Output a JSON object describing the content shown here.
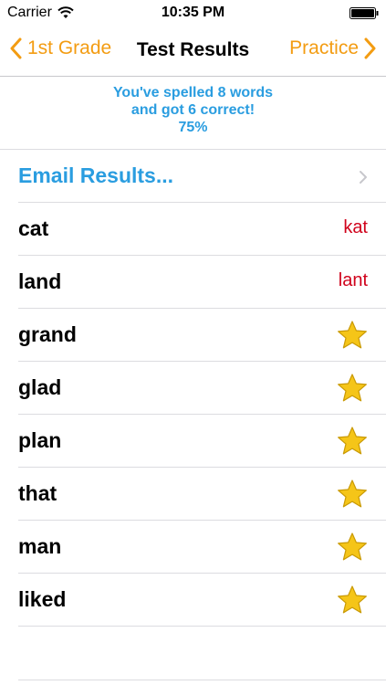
{
  "status_bar": {
    "carrier": "Carrier",
    "time": "10:35 PM"
  },
  "nav": {
    "back_label": "1st Grade",
    "title": "Test Results",
    "forward_label": "Practice"
  },
  "summary": {
    "line1": "You've spelled 8 words",
    "line2": "and got 6 correct!",
    "line3": "75%"
  },
  "email": {
    "label": "Email Results..."
  },
  "results": [
    {
      "word": "cat",
      "correct": false,
      "answer": "kat"
    },
    {
      "word": "land",
      "correct": false,
      "answer": "lant"
    },
    {
      "word": "grand",
      "correct": true,
      "answer": ""
    },
    {
      "word": "glad",
      "correct": true,
      "answer": ""
    },
    {
      "word": "plan",
      "correct": true,
      "answer": ""
    },
    {
      "word": "that",
      "correct": true,
      "answer": ""
    },
    {
      "word": "man",
      "correct": true,
      "answer": ""
    },
    {
      "word": "liked",
      "correct": true,
      "answer": ""
    }
  ],
  "colors": {
    "accent_orange": "#f39c12",
    "accent_blue": "#2a9de0",
    "wrong_red": "#d0021b",
    "star_gold": "#f5c518"
  },
  "icons": {
    "wifi": "wifi-icon",
    "battery": "battery-icon",
    "back": "chevron-left-icon",
    "forward": "chevron-right-icon",
    "disclosure": "chevron-right-icon",
    "correct": "star-icon"
  }
}
